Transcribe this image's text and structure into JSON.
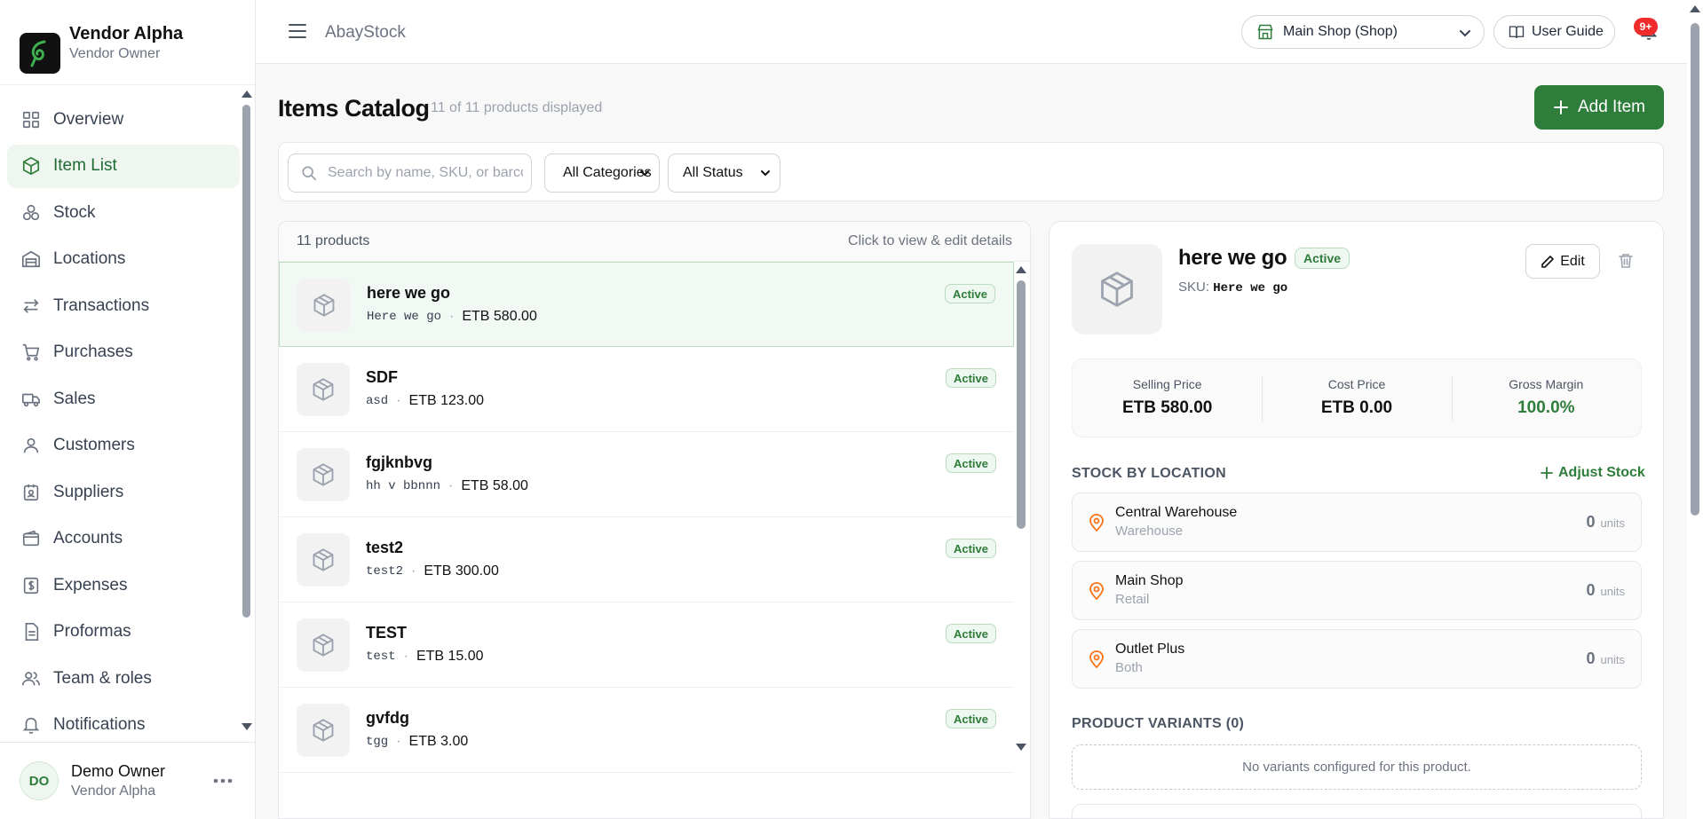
{
  "brand": {
    "name": "Vendor Alpha",
    "role": "Vendor Owner",
    "logo_icon": "leaf-logo-icon"
  },
  "nav": {
    "items": [
      {
        "label": "Overview",
        "icon": "grid-icon",
        "active": false
      },
      {
        "label": "Item List",
        "icon": "box-icon",
        "active": true
      },
      {
        "label": "Stock",
        "icon": "boxes-icon",
        "active": false
      },
      {
        "label": "Locations",
        "icon": "warehouse-icon",
        "active": false
      },
      {
        "label": "Transactions",
        "icon": "arrows-icon",
        "active": false
      },
      {
        "label": "Purchases",
        "icon": "cart-icon",
        "active": false
      },
      {
        "label": "Sales",
        "icon": "truck-icon",
        "active": false
      },
      {
        "label": "Customers",
        "icon": "user-icon",
        "active": false
      },
      {
        "label": "Suppliers",
        "icon": "supplier-icon",
        "active": false
      },
      {
        "label": "Accounts",
        "icon": "wallet-icon",
        "active": false
      },
      {
        "label": "Expenses",
        "icon": "receipt-icon",
        "active": false
      },
      {
        "label": "Proformas",
        "icon": "document-icon",
        "active": false
      },
      {
        "label": "Team & roles",
        "icon": "users-icon",
        "active": false
      },
      {
        "label": "Notifications",
        "icon": "bell-icon",
        "active": false
      }
    ]
  },
  "user": {
    "initials": "DO",
    "name": "Demo Owner",
    "org": "Vendor Alpha"
  },
  "topbar": {
    "app_title": "AbayStock",
    "shop_select": "Main Shop (Shop)",
    "user_guide": "User Guide",
    "notification_badge": "9+"
  },
  "page": {
    "title": "Items Catalog",
    "subtitle": "11 of 11 products displayed",
    "add_button": "Add Item"
  },
  "filters": {
    "search_placeholder": "Search by name, SKU, or barcode",
    "category": "All Categories",
    "status": "All Status"
  },
  "list": {
    "count_label": "11 products",
    "hint": "Click to view & edit details",
    "rows": [
      {
        "name": "here we go",
        "sku": "Here we go",
        "price": "ETB 580.00",
        "status": "Active",
        "selected": true
      },
      {
        "name": "SDF",
        "sku": "asd",
        "price": "ETB 123.00",
        "status": "Active",
        "selected": false
      },
      {
        "name": "fgjknbvg",
        "sku": "hh v bbnnn",
        "price": "ETB 58.00",
        "status": "Active",
        "selected": false
      },
      {
        "name": "test2",
        "sku": "test2",
        "price": "ETB 300.00",
        "status": "Active",
        "selected": false
      },
      {
        "name": "TEST",
        "sku": "test",
        "price": "ETB 15.00",
        "status": "Active",
        "selected": false
      },
      {
        "name": "gvfdg",
        "sku": "tgg",
        "price": "ETB 3.00",
        "status": "Active",
        "selected": false
      }
    ],
    "separator": "·"
  },
  "detail": {
    "name": "here we go",
    "status": "Active",
    "sku_label": "SKU:",
    "sku_value": "Here we go",
    "edit_label": "Edit",
    "stats": [
      {
        "label": "Selling Price",
        "value": "ETB 580.00"
      },
      {
        "label": "Cost Price",
        "value": "ETB 0.00"
      },
      {
        "label": "Gross Margin",
        "value": "100.0%"
      }
    ],
    "stock_title": "STOCK BY LOCATION",
    "adjust_label": "Adjust Stock",
    "locations": [
      {
        "name": "Central Warehouse",
        "type": "Warehouse",
        "qty": "0",
        "unit": "units"
      },
      {
        "name": "Main Shop",
        "type": "Retail",
        "qty": "0",
        "unit": "units"
      },
      {
        "name": "Outlet Plus",
        "type": "Both",
        "qty": "0",
        "unit": "units"
      }
    ],
    "variants_title": "PRODUCT VARIANTS (0)",
    "variants_empty": "No variants configured for this product."
  },
  "colors": {
    "accent": "#2e7d3a",
    "badge_red": "#ef2b2b",
    "pin": "#f97316"
  }
}
